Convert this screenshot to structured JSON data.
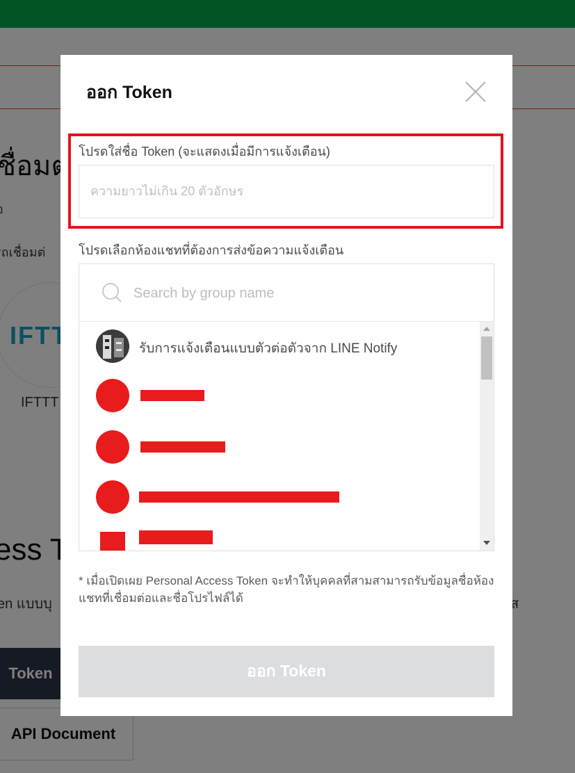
{
  "background": {
    "heading": "ชื่อมต",
    "sub1": "อ",
    "sub2": "รถเชื่อมต่",
    "service_logo": "IFTT",
    "service_label": "IFTTT",
    "access_heading": "ess T",
    "description_left": "en แบบบุ",
    "description_right": "ส",
    "issue_token_button": "Token",
    "api_document_button": "API Document"
  },
  "modal": {
    "title": "ออก Token",
    "close_icon": "close-icon",
    "token_name": {
      "label": "โปรดใส่ชื่อ Token (จะแสดงเมื่อมีการแจ้งเตือน)",
      "placeholder": "ความยาวไม่เกิน 20 ตัวอักษร",
      "value": ""
    },
    "room_select": {
      "label": "โปรดเลือกห้องแชทที่ต้องการส่งข้อความแจ้งเตือน",
      "search_placeholder": "Search by group name",
      "search_icon": "search-icon",
      "rooms": [
        {
          "name": "รับการแจ้งเตือนแบบตัวต่อตัวจาก LINE Notify",
          "redacted": false
        },
        {
          "name": "",
          "redacted": true
        },
        {
          "name": "",
          "redacted": true
        },
        {
          "name": "",
          "redacted": true
        },
        {
          "name": "",
          "redacted": true
        }
      ]
    },
    "disclaimer": "* เมื่อเปิดเผย Personal Access Token จะทำให้บุคคลที่สามสามารถรับข้อมูลชื่อห้องแชทที่เชื่อมต่อและชื่อโปรไฟล์ได้",
    "submit_button": "ออก Token"
  },
  "colors": {
    "top_bar": "#06a84a",
    "highlight_box": "#e3141e",
    "redaction": "#e81c1c",
    "disabled_button": "#dcdde0"
  }
}
